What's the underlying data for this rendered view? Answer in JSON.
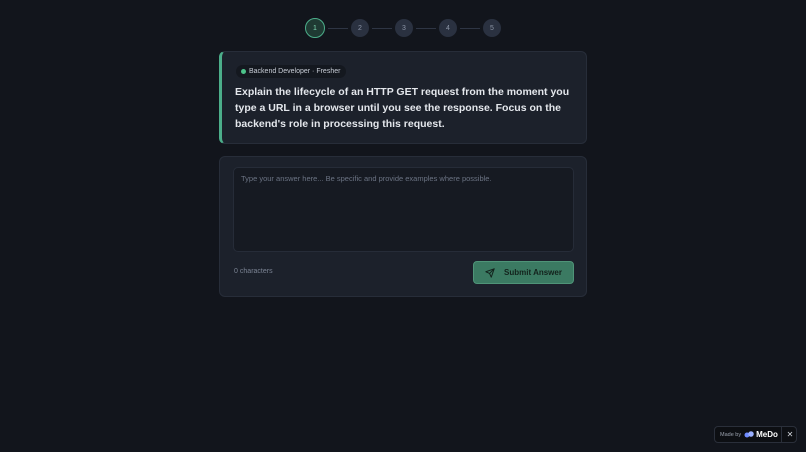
{
  "stepper": {
    "steps": [
      "1",
      "2",
      "3",
      "4",
      "5"
    ],
    "active_step": 1
  },
  "question": {
    "badge": "Backend Developer · Fresher",
    "text": "Explain the lifecycle of an HTTP GET request from the moment you type a URL in a browser until you see the response. Focus on the backend's role in processing this request."
  },
  "answer": {
    "placeholder": "Type your answer here... Be specific and provide examples where possible.",
    "value": "",
    "char_count": "0",
    "char_label": "characters",
    "submit_label": "Submit Answer"
  },
  "made_by": {
    "prefix": "Made by",
    "brand": "MeDo",
    "close": "✕"
  },
  "colors": {
    "background": "#12151c",
    "card": "#1c212b",
    "accent": "#4cae8a",
    "button": "#3b7a62"
  },
  "icons": {
    "submit": "send-icon",
    "badge": "status-dot",
    "logo": "medo-logo-icon",
    "close": "close-icon"
  }
}
